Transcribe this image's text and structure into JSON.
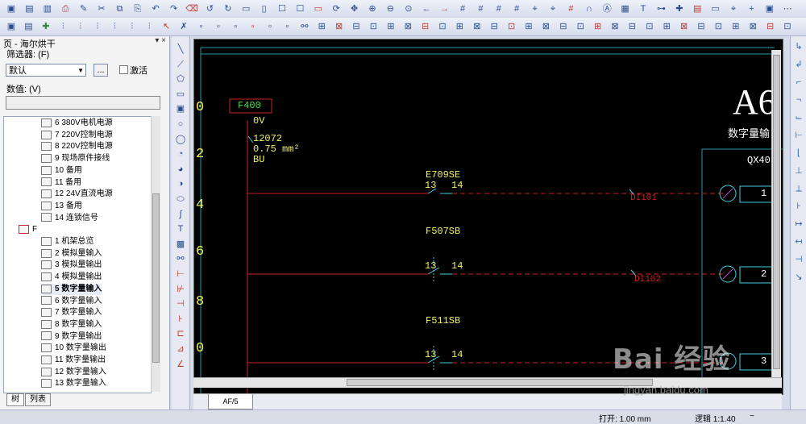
{
  "toolbar_icons_row1": [
    "folder-open",
    "save",
    "save-as",
    "print",
    "wrench",
    "cut",
    "copy",
    "paste",
    "undo-edit",
    "redo-edit",
    "eraser",
    "undo",
    "redo",
    "window",
    "window2",
    "page",
    "page2",
    "screen",
    "refresh",
    "pan",
    "zoom-in",
    "zoom-out",
    "zoom-100",
    "back",
    "forward",
    "grid",
    "grid2",
    "grid3",
    "grid4",
    "snap",
    "snap2",
    "grid5",
    "magnet",
    "auto",
    "frame",
    "text",
    "wire",
    "cross",
    "table",
    "box",
    "crosshair",
    "plus",
    "select",
    "more"
  ],
  "toolbar_icons_row2": [
    "open",
    "open2",
    "plugin",
    "pin1",
    "pin2",
    "pin3",
    "pin4",
    "pin5",
    "pin6",
    "arrow-sel",
    "delete",
    "page-new",
    "page-copy",
    "page-paste",
    "page-up",
    "page-down",
    "page-x",
    "link",
    "sym1",
    "sym2",
    "sym3",
    "sym4",
    "sym5",
    "sym6",
    "sym7",
    "sym8",
    "sym9",
    "sym10",
    "sym11",
    "sym12",
    "sym13",
    "sym14",
    "sym15",
    "sym16",
    "sym17",
    "sym18",
    "sym19",
    "sym20",
    "sym21",
    "sym22",
    "sym23",
    "sym24",
    "sym25",
    "sym26",
    "sym27",
    "sym28"
  ],
  "panel": {
    "title": "页 - 海尔烘干",
    "controls": "▾ ×",
    "filter_label": "筛选器: (F)",
    "filter_value": "默认",
    "more_button": "...",
    "activate_label": "激活",
    "value_label": "数值: (V)"
  },
  "tree": {
    "items": [
      {
        "label": "6 380V电机电源",
        "indent": 50,
        "selected": false
      },
      {
        "label": "7 220V控制电源",
        "indent": 50,
        "selected": false
      },
      {
        "label": "8 220V控制电源",
        "indent": 50,
        "selected": false
      },
      {
        "label": "9 现场原件接线",
        "indent": 50,
        "selected": false
      },
      {
        "label": "10 备用",
        "indent": 50,
        "selected": false
      },
      {
        "label": "11 备用",
        "indent": 50,
        "selected": false
      },
      {
        "label": "12 24V直流电源",
        "indent": 50,
        "selected": false
      },
      {
        "label": "13 备用",
        "indent": 50,
        "selected": false
      },
      {
        "label": "14 连锁信号",
        "indent": 50,
        "selected": false
      },
      {
        "label": "F",
        "indent": 22,
        "selected": false,
        "folder": true
      },
      {
        "label": "1 机架总览",
        "indent": 50,
        "selected": false
      },
      {
        "label": "2 模拟量输入",
        "indent": 50,
        "selected": false
      },
      {
        "label": "3 模拟量输出",
        "indent": 50,
        "selected": false
      },
      {
        "label": "4 模拟量输出",
        "indent": 50,
        "selected": false
      },
      {
        "label": "5 数字量输入",
        "indent": 50,
        "selected": true
      },
      {
        "label": "6 数字量输入",
        "indent": 50,
        "selected": false
      },
      {
        "label": "7 数字量输入",
        "indent": 50,
        "selected": false
      },
      {
        "label": "8 数字量输入",
        "indent": 50,
        "selected": false
      },
      {
        "label": "9 数字量输出",
        "indent": 50,
        "selected": false
      },
      {
        "label": "10 数字量输出",
        "indent": 50,
        "selected": false
      },
      {
        "label": "11 数字量输出",
        "indent": 50,
        "selected": false
      },
      {
        "label": "12 数字量输入",
        "indent": 50,
        "selected": false
      },
      {
        "label": "13 数字量输入",
        "indent": 50,
        "selected": false
      }
    ],
    "tab_tree": "树",
    "tab_list": "列表"
  },
  "canvas": {
    "row_numbers": [
      "0",
      "2",
      "4",
      "6",
      "8",
      "0"
    ],
    "terminal_label": "F400",
    "voltage": "0V",
    "wire_number": "12072",
    "wire_size": "0.75 mm²",
    "wire_color": "BU",
    "component1": "E709SE",
    "component2": "F507SB",
    "component3": "F511SB",
    "contact_13": "13",
    "contact_14": "14",
    "signal1": "DI101",
    "signal2": "DI102",
    "big_title": "A6",
    "subtitle": "数字量输",
    "module": "QX40",
    "pin1": "1",
    "pin2": "2",
    "pin3": "3",
    "colors": {
      "grid": "#1f9aa8",
      "wire": "#cc2222",
      "label_yellow": "#f2f25a",
      "label_cyan": "#3fd2e0",
      "terminal_green": "#3fd93f"
    }
  },
  "page_tab": "AF/5",
  "status": {
    "open": "打开: 1.00 mm",
    "scale": "逻辑 1:1.40",
    "extra": "~"
  },
  "watermark": {
    "text": "Bai 经验",
    "url": "jingyan.baidu.com"
  }
}
